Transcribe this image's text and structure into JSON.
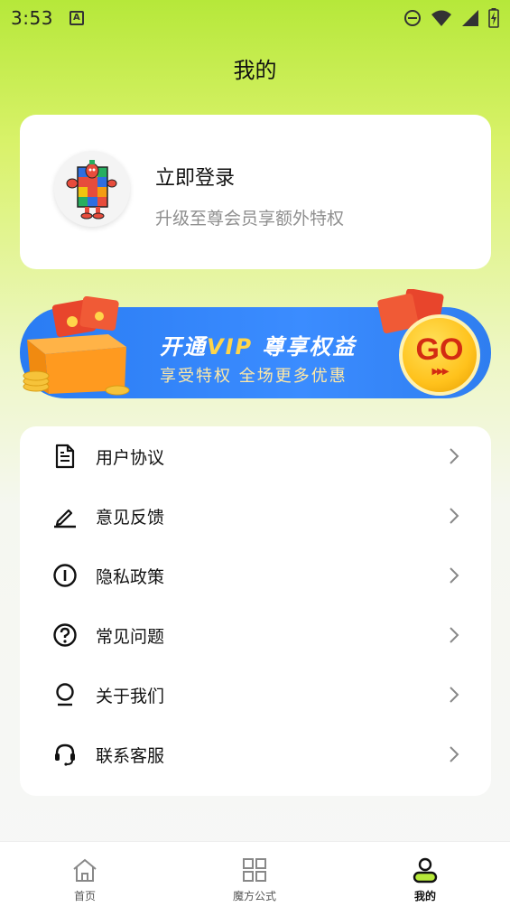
{
  "status_bar": {
    "time": "3:53",
    "icons": [
      "text-notification-icon",
      "dnd-icon",
      "wifi-icon",
      "signal-icon",
      "battery-icon"
    ]
  },
  "header": {
    "title": "我的"
  },
  "login_card": {
    "title": "立即登录",
    "subtitle": "升级至尊会员享额外特权",
    "avatar": "rubiks-cube-mascot-avatar"
  },
  "vip_banner": {
    "title_part1": "开通",
    "title_highlight": "VIP",
    "title_part2": " 尊享权益",
    "subtitle": "享受特权 全场更多优惠",
    "go_label": "GO",
    "colors": {
      "background": "#2f82f5",
      "accent": "#ffd54a",
      "go": "#ffc21c"
    }
  },
  "menu": {
    "items": [
      {
        "label": "用户协议",
        "icon": "document-icon"
      },
      {
        "label": "意见反馈",
        "icon": "pencil-icon"
      },
      {
        "label": "隐私政策",
        "icon": "info-circle-icon"
      },
      {
        "label": "常见问题",
        "icon": "question-circle-icon"
      },
      {
        "label": "关于我们",
        "icon": "lightbulb-icon"
      },
      {
        "label": "联系客服",
        "icon": "headset-icon"
      }
    ]
  },
  "bottom_nav": {
    "items": [
      {
        "label": "首页",
        "icon": "home-icon",
        "active": false
      },
      {
        "label": "魔方公式",
        "icon": "grid-icon",
        "active": false
      },
      {
        "label": "我的",
        "icon": "user-icon",
        "active": true
      }
    ],
    "accent": "#b6e83a"
  }
}
